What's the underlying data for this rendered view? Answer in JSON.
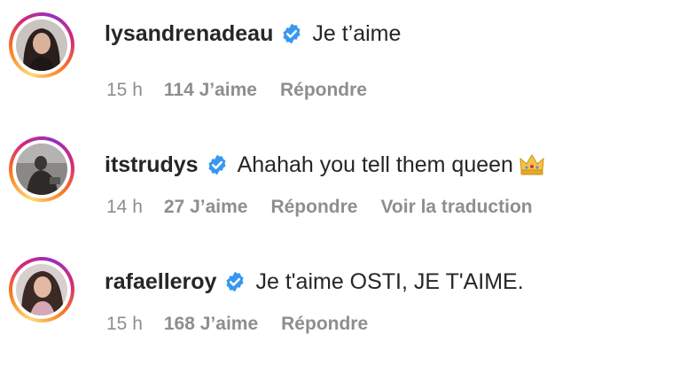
{
  "comments": [
    {
      "username": "lysandrenadeau",
      "text": "Je t’aime",
      "time": "15 h",
      "likes": "114 J’aime",
      "reply": "Répondre"
    },
    {
      "username": "itstrudys",
      "text": "Ahahah you tell them queen",
      "emoji": "crown-icon",
      "time": "14 h",
      "likes": "27 J’aime",
      "reply": "Répondre",
      "translate": "Voir la traduction"
    },
    {
      "username": "rafaelleroy",
      "text": "Je t'aime OSTI, JE T'AIME.",
      "time": "15 h",
      "likes": "168 J’aime",
      "reply": "Répondre"
    }
  ],
  "colors": {
    "verified": "#3897f0",
    "text": "#262626",
    "meta": "#8e8e8e"
  }
}
